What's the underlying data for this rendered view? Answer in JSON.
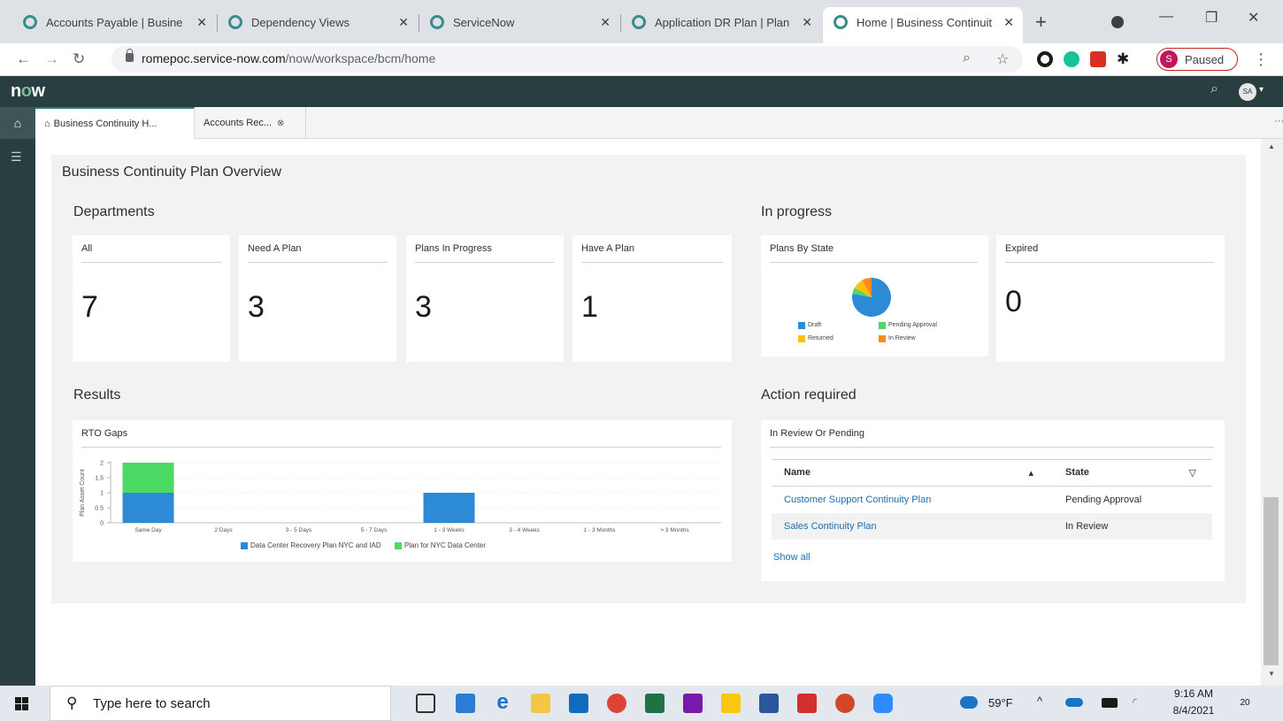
{
  "browser": {
    "tabs": [
      {
        "title": "Accounts Payable | Busine"
      },
      {
        "title": "Dependency Views"
      },
      {
        "title": "ServiceNow"
      },
      {
        "title": "Application DR Plan | Plan"
      },
      {
        "title": "Home | Business Continuit"
      }
    ],
    "close_glyph": "✕",
    "new_tab_glyph": "+",
    "url_host": "romepoc.service-now.com",
    "url_path": "/now/workspace/bcm/home",
    "profile_initial": "S",
    "profile_status": "Paused"
  },
  "header": {
    "logo_n": "n",
    "logo_o": "o",
    "logo_w": "w",
    "avatar_initials": "SA"
  },
  "workspace_tabs": [
    {
      "label": "Business Continuity H..."
    },
    {
      "label": "Accounts Rec..."
    }
  ],
  "overview": {
    "title": "Business Continuity Plan Overview",
    "departments": {
      "title": "Departments",
      "cards": [
        {
          "label": "All",
          "value": "7"
        },
        {
          "label": "Need A Plan",
          "value": "3"
        },
        {
          "label": "Plans In Progress",
          "value": "3"
        },
        {
          "label": "Have A Plan",
          "value": "1"
        }
      ]
    },
    "in_progress": {
      "title": "In progress",
      "plans_by_state": {
        "label": "Plans By State",
        "legend": [
          {
            "name": "Draft",
            "color": "#2d8ad6"
          },
          {
            "name": "Pending Approval",
            "color": "#4cd964"
          },
          {
            "name": "Returned",
            "color": "#ffc107"
          },
          {
            "name": "In Review",
            "color": "#ff8c1a"
          }
        ]
      },
      "expired": {
        "label": "Expired",
        "value": "0"
      }
    },
    "results": {
      "title": "Results",
      "card_label": "RTO Gaps"
    },
    "action_required": {
      "title": "Action required",
      "card_label": "In Review Or Pending",
      "columns": {
        "name": "Name",
        "state": "State"
      },
      "rows": [
        {
          "name": "Customer Support Continuity Plan",
          "state": "Pending Approval"
        },
        {
          "name": "Sales Continuity Plan",
          "state": "In Review"
        }
      ],
      "show_all": "Show all"
    }
  },
  "chart_data": {
    "type": "bar",
    "stacked": true,
    "title": "",
    "xlabel": "",
    "ylabel": "Plan Asset Count",
    "categories": [
      "Same Day",
      "2 Days",
      "3 - 5 Days",
      "5 - 7 Days",
      "1 - 3 Weeks",
      "3 - 4 Weeks",
      "1 - 3 Months",
      "> 3 Months"
    ],
    "series": [
      {
        "name": "Data Center Recovery Plan NYC and IAD",
        "color": "#2d8ad6",
        "values": [
          1,
          0,
          0,
          0,
          1,
          0,
          0,
          0
        ]
      },
      {
        "name": "Plan for NYC Data Center",
        "color": "#4cd964",
        "values": [
          1,
          0,
          0,
          0,
          0,
          0,
          0,
          0
        ]
      }
    ],
    "yticks": [
      "0",
      "0.5",
      "1",
      "1.5",
      "2"
    ],
    "ylim": [
      0,
      2
    ],
    "grid": true,
    "legend": "bottom"
  },
  "pie_data": {
    "type": "pie",
    "slices": [
      {
        "name": "Draft",
        "value": 0.78,
        "color": "#2d8ad6"
      },
      {
        "name": "Pending Approval",
        "value": 0.05,
        "color": "#4cd964"
      },
      {
        "name": "Returned",
        "value": 0.09,
        "color": "#ffc107"
      },
      {
        "name": "In Review",
        "value": 0.08,
        "color": "#ff8c1a"
      }
    ]
  },
  "taskbar": {
    "search_placeholder": "Type here to search",
    "weather": "59°F",
    "time": "9:16 AM",
    "date": "8/4/2021",
    "notifications": "20"
  }
}
